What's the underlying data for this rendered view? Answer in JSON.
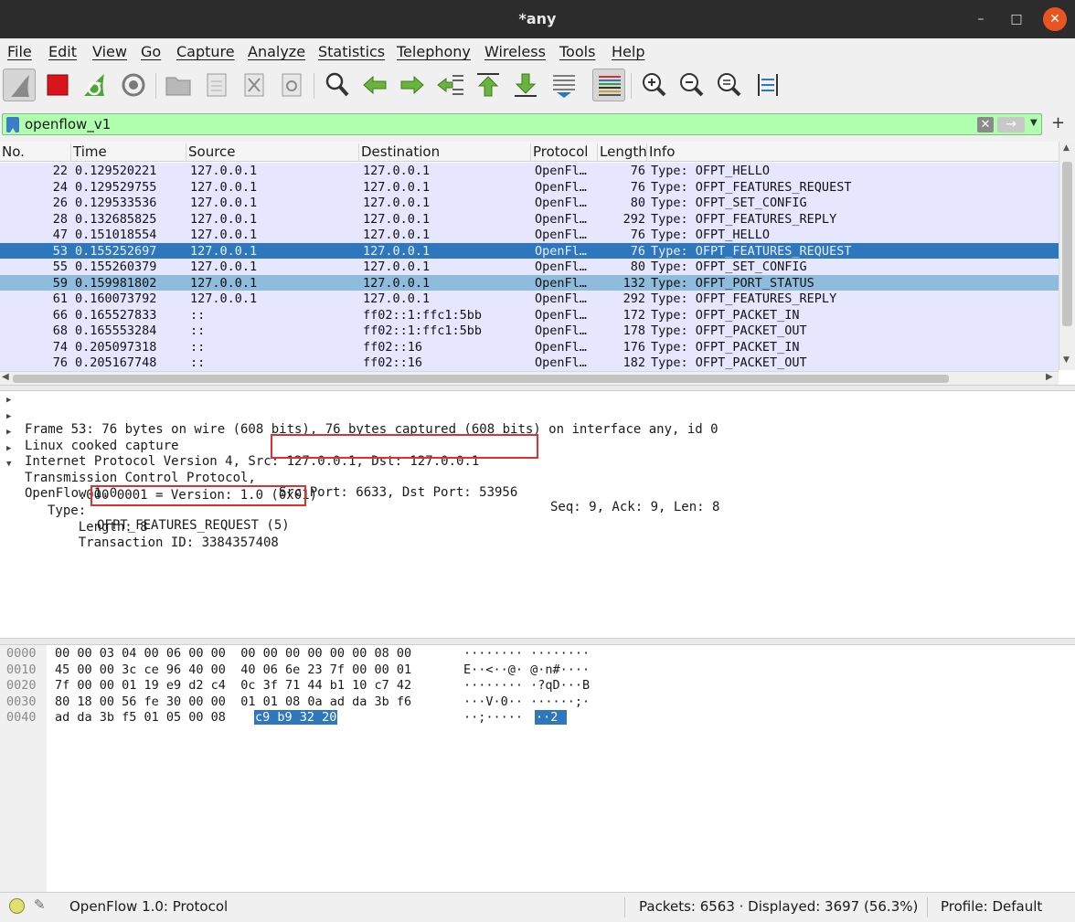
{
  "window": {
    "title": "*any"
  },
  "menu": [
    "File",
    "Edit",
    "View",
    "Go",
    "Capture",
    "Analyze",
    "Statistics",
    "Telephony",
    "Wireless",
    "Tools",
    "Help"
  ],
  "toolbar": {
    "icons": [
      "shark-fin-start-icon",
      "stop-capture-icon",
      "restart-capture-icon",
      "capture-options-icon",
      "open-file-icon",
      "save-file-icon",
      "close-file-icon",
      "reload-file-icon",
      "find-packet-icon",
      "go-back-icon",
      "go-forward-icon",
      "go-to-packet-icon",
      "go-first-packet-icon",
      "go-last-packet-icon",
      "auto-scroll-icon",
      "colorize-icon",
      "zoom-in-icon",
      "zoom-out-icon",
      "normal-size-icon",
      "resize-columns-icon"
    ]
  },
  "filter": {
    "value": "openflow_v1"
  },
  "packet_list": {
    "columns": [
      "No.",
      "Time",
      "Source",
      "Destination",
      "Protocol",
      "Length",
      "Info"
    ],
    "rows": [
      {
        "no": "22",
        "time": "0.129520221",
        "src": "127.0.0.1",
        "dst": "127.0.0.1",
        "proto": "OpenFl…",
        "len": "76",
        "info": "Type: OFPT_HELLO"
      },
      {
        "no": "24",
        "time": "0.129529755",
        "src": "127.0.0.1",
        "dst": "127.0.0.1",
        "proto": "OpenFl…",
        "len": "76",
        "info": "Type: OFPT_FEATURES_REQUEST"
      },
      {
        "no": "26",
        "time": "0.129533536",
        "src": "127.0.0.1",
        "dst": "127.0.0.1",
        "proto": "OpenFl…",
        "len": "80",
        "info": "Type: OFPT_SET_CONFIG"
      },
      {
        "no": "28",
        "time": "0.132685825",
        "src": "127.0.0.1",
        "dst": "127.0.0.1",
        "proto": "OpenFl…",
        "len": "292",
        "info": "Type: OFPT_FEATURES_REPLY"
      },
      {
        "no": "47",
        "time": "0.151018554",
        "src": "127.0.0.1",
        "dst": "127.0.0.1",
        "proto": "OpenFl…",
        "len": "76",
        "info": "Type: OFPT_HELLO"
      },
      {
        "no": "53",
        "time": "0.155252697",
        "src": "127.0.0.1",
        "dst": "127.0.0.1",
        "proto": "OpenFl…",
        "len": "76",
        "info": "Type: OFPT_FEATURES_REQUEST"
      },
      {
        "no": "55",
        "time": "0.155260379",
        "src": "127.0.0.1",
        "dst": "127.0.0.1",
        "proto": "OpenFl…",
        "len": "80",
        "info": "Type: OFPT_SET_CONFIG"
      },
      {
        "no": "59",
        "time": "0.159981802",
        "src": "127.0.0.1",
        "dst": "127.0.0.1",
        "proto": "OpenFl…",
        "len": "132",
        "info": "Type: OFPT_PORT_STATUS"
      },
      {
        "no": "61",
        "time": "0.160073792",
        "src": "127.0.0.1",
        "dst": "127.0.0.1",
        "proto": "OpenFl…",
        "len": "292",
        "info": "Type: OFPT_FEATURES_REPLY"
      },
      {
        "no": "66",
        "time": "0.165527833",
        "src": "::",
        "dst": "ff02::1:ffc1:5bb",
        "proto": "OpenFl…",
        "len": "172",
        "info": "Type: OFPT_PACKET_IN"
      },
      {
        "no": "68",
        "time": "0.165553284",
        "src": "::",
        "dst": "ff02::1:ffc1:5bb",
        "proto": "OpenFl…",
        "len": "178",
        "info": "Type: OFPT_PACKET_OUT"
      },
      {
        "no": "74",
        "time": "0.205097318",
        "src": "::",
        "dst": "ff02::16",
        "proto": "OpenFl…",
        "len": "176",
        "info": "Type: OFPT_PACKET_IN"
      },
      {
        "no": "76",
        "time": "0.205167748",
        "src": "::",
        "dst": "ff02::16",
        "proto": "OpenFl…",
        "len": "182",
        "info": "Type: OFPT_PACKET_OUT"
      }
    ]
  },
  "details": {
    "frame": "Frame 53: 76 bytes on wire (608 bits), 76 bytes captured (608 bits) on interface any, id 0",
    "linux": "Linux cooked capture",
    "ip": "Internet Protocol Version 4, Src: 127.0.0.1, Dst: 127.0.0.1",
    "tcp_prefix": "Transmission Control Protocol,",
    "tcp_ports": "Src Port: 6633, Dst Port: 53956",
    "tcp_suffix": "Seq: 9, Ack: 9, Len: 8",
    "openflow": "OpenFlow 1.0",
    "version": ".000 0001 = Version: 1.0 (0x01)",
    "type_label": "Type:",
    "type_value": "OFPT_FEATURES_REQUEST (5)",
    "length": "Length: 8",
    "xid": "Transaction ID: 3384357408"
  },
  "bytes": {
    "rows": [
      {
        "off": "0000",
        "hex": "00 00 03 04 00 06 00 00  00 00 00 00 00 00 08 00",
        "ascii": "········ ········"
      },
      {
        "off": "0010",
        "hex": "45 00 00 3c ce 96 40 00  40 06 6e 23 7f 00 00 01",
        "ascii": "E··<··@· @·n#····"
      },
      {
        "off": "0020",
        "hex": "7f 00 00 01 19 e9 d2 c4  0c 3f 71 44 b1 10 c7 42",
        "ascii": "········ ·?qD···B"
      },
      {
        "off": "0030",
        "hex": "80 18 00 56 fe 30 00 00  01 01 08 0a ad da 3b f6",
        "ascii": "···V·0·· ······;·"
      },
      {
        "off": "0040",
        "hex": "ad da 3b f5 01 05 00 08",
        "ascii": "··;·····"
      }
    ],
    "hl_hex": "c9 b9 32 20",
    "hl_ascii": "··2 "
  },
  "status": {
    "protocol": "OpenFlow 1.0: Protocol",
    "packets": "Packets: 6563 · Displayed: 3697 (56.3%)",
    "profile": "Profile: Default"
  }
}
